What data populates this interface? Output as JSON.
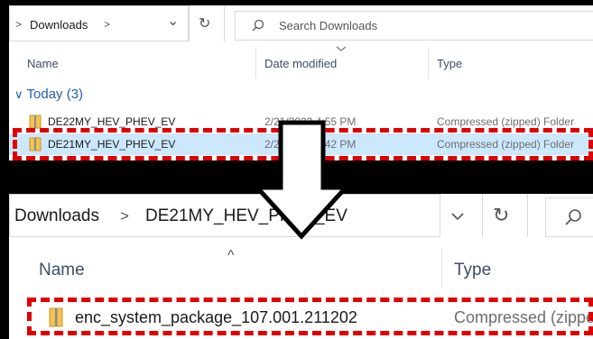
{
  "top_window": {
    "breadcrumb_chevron_left": ">",
    "address_folder": "Downloads",
    "address_chevron": ">",
    "dropdown_chevron": "⌄",
    "refresh_icon": "↻",
    "search_placeholder": "Search Downloads",
    "columns": {
      "name": "Name",
      "date": "Date modified",
      "type": "Type"
    },
    "group": {
      "chevron": "∨",
      "label": "Today (3)"
    },
    "rows": [
      {
        "name": "DE22MY_HEV_PHEV_EV",
        "date": "2/21/2022 4:55 PM",
        "type": "Compressed (zipped) Folder"
      },
      {
        "name": "DE21MY_HEV_PHEV_EV",
        "date": "2/21/2022 4:42 PM",
        "type": "Compressed (zipped) Folder"
      }
    ]
  },
  "bottom_window": {
    "address_folder": "Downloads",
    "address_sep": ">",
    "address_subfolder": "DE21MY_HEV_PHEV_EV",
    "dropdown_chevron": "⌄",
    "refresh_icon": "↻",
    "columns": {
      "name": "Name",
      "type": "Type",
      "sort_caret": "^"
    },
    "rows": [
      {
        "name": "enc_system_package_107.001.211202",
        "type": "Compressed (zipped)"
      }
    ]
  }
}
